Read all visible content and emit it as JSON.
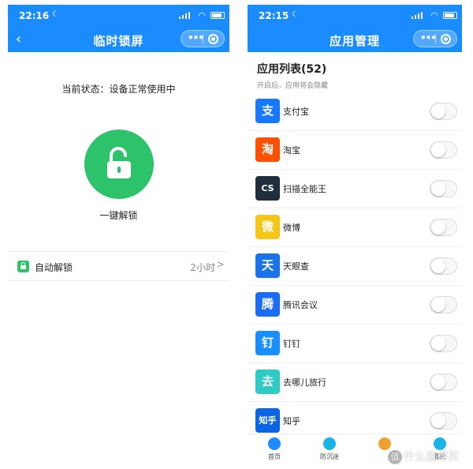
{
  "colors": {
    "primary": "#1a8cff",
    "green": "#2dc36b"
  },
  "left_screen": {
    "status_time": "22:16",
    "nav_title": "临时锁屏",
    "status_text": "当前状态：设备正常使用中",
    "unlock_label": "一键解锁",
    "auto_unlock": {
      "label": "自动解锁",
      "value": "2小时",
      "chevron": ">"
    }
  },
  "right_screen": {
    "status_time": "22:15",
    "nav_title": "应用管理",
    "list_title": "应用列表(52)",
    "list_subtitle": "开启后，应用将会隐藏",
    "apps": [
      {
        "name": "支付宝",
        "icon_text": "支",
        "color": "#1677ff",
        "enabled": false
      },
      {
        "name": "淘宝",
        "icon_text": "淘",
        "color": "#ff5000",
        "enabled": false
      },
      {
        "name": "扫描全能王",
        "icon_text": "CS",
        "color": "#1f2d3d",
        "enabled": false
      },
      {
        "name": "微博",
        "icon_text": "微",
        "color": "#f5c518",
        "enabled": false
      },
      {
        "name": "天眼查",
        "icon_text": "天",
        "color": "#1a73e8",
        "enabled": false
      },
      {
        "name": "腾讯会议",
        "icon_text": "腾",
        "color": "#1a6cf5",
        "enabled": false
      },
      {
        "name": "钉钉",
        "icon_text": "钉",
        "color": "#1890ff",
        "enabled": false
      },
      {
        "name": "去哪儿旅行",
        "icon_text": "去",
        "color": "#2ecbc4",
        "enabled": false
      },
      {
        "name": "知乎",
        "icon_text": "知乎",
        "color": "#0a66e4",
        "enabled": false
      }
    ],
    "tabs": [
      {
        "label": "首页",
        "icon": "home-icon",
        "color": "#1a8cff"
      },
      {
        "label": "防沉迷",
        "icon": "shield-icon",
        "color": "#1ab4e8"
      },
      {
        "label": "",
        "icon": "child-icon",
        "color": "#f0a030"
      },
      {
        "label": "我的",
        "icon": "user-icon",
        "color": "#1ab4e8"
      }
    ],
    "watermark": "什么值得买",
    "watermark_badge": "值"
  }
}
